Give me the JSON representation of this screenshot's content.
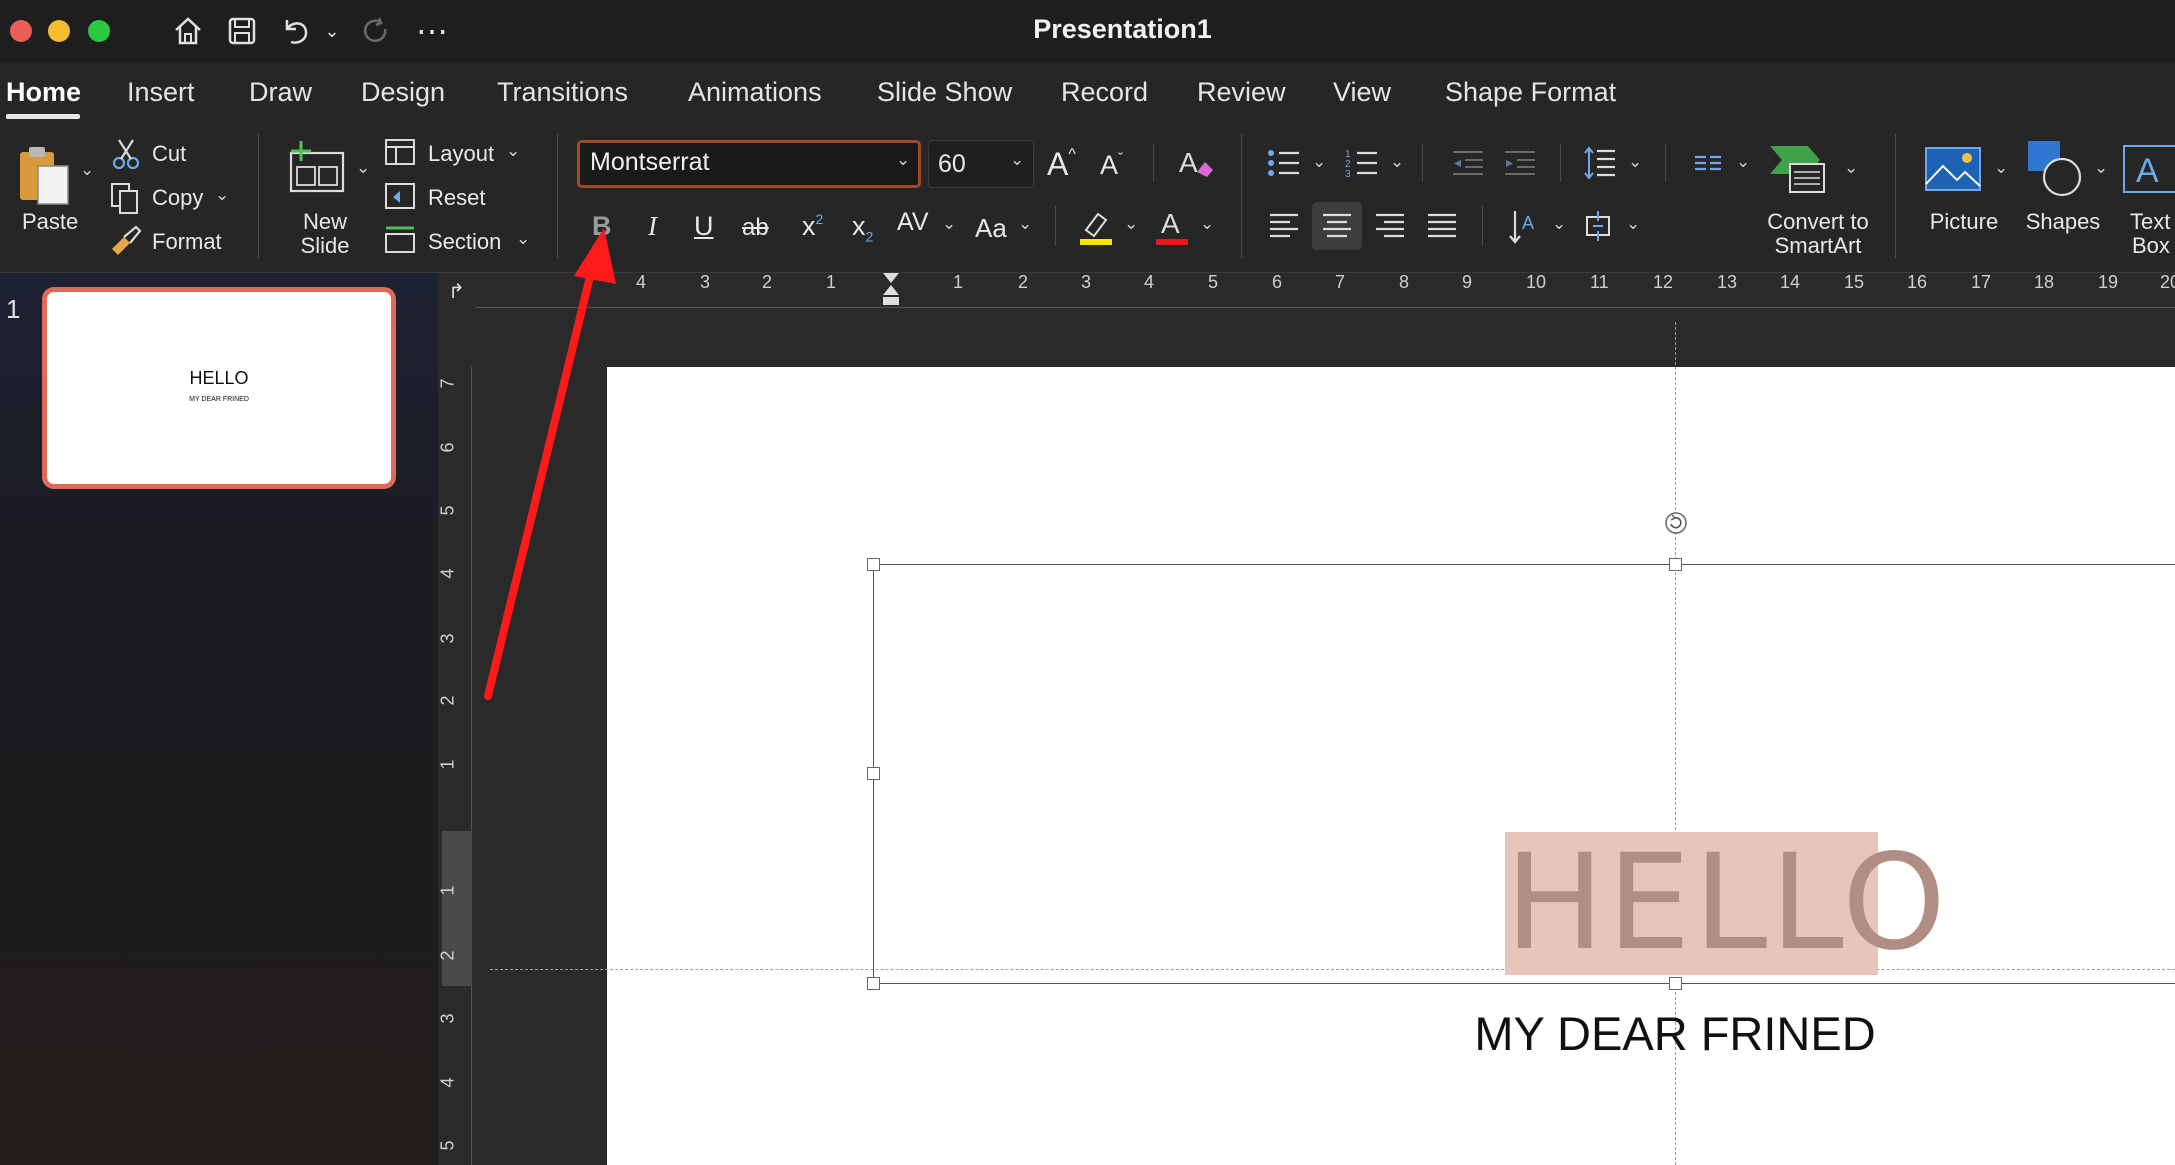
{
  "window": {
    "title": "Presentation1",
    "traffic_lights": [
      "#ec5f57",
      "#f4be2f",
      "#2cc840"
    ]
  },
  "quick_access": {
    "icons": [
      "home-icon",
      "save-icon",
      "undo-icon",
      "chevron-down-icon",
      "redo-icon",
      "more-icon"
    ]
  },
  "tabs": [
    {
      "label": "Home",
      "active": true
    },
    {
      "label": "Insert"
    },
    {
      "label": "Draw"
    },
    {
      "label": "Design"
    },
    {
      "label": "Transitions"
    },
    {
      "label": "Animations"
    },
    {
      "label": "Slide Show"
    },
    {
      "label": "Record"
    },
    {
      "label": "Review"
    },
    {
      "label": "View"
    },
    {
      "label": "Shape Format"
    }
  ],
  "ribbon": {
    "paste": "Paste",
    "cut": "Cut",
    "copy": "Copy",
    "format": "Format",
    "new_slide_line1": "New",
    "new_slide_line2": "Slide",
    "layout": "Layout",
    "reset": "Reset",
    "section": "Section",
    "font_name": "Montserrat",
    "font_size": "60",
    "bold": "B",
    "italic": "I",
    "underline": "U",
    "strike": "ab",
    "superscript": "x",
    "subscript": "x",
    "char_spacing": "AV",
    "change_case": "Aa",
    "convert_line1": "Convert to",
    "convert_line2": "SmartArt",
    "picture": "Picture",
    "shapes": "Shapes",
    "textbox_line1": "Text",
    "textbox_line2": "Box",
    "highlight_color": "#f5e600",
    "font_color": "#e51b1b"
  },
  "slides_panel": {
    "slide_number": "1",
    "thumb_title": "HELLO",
    "thumb_subtitle": "MY DEAR FRINED"
  },
  "rulers": {
    "horizontal": [
      "4",
      "3",
      "2",
      "1",
      "1",
      "2",
      "3",
      "4",
      "5",
      "6",
      "7",
      "8",
      "9",
      "10",
      "11",
      "12",
      "13",
      "14",
      "15",
      "16",
      "17",
      "18",
      "19",
      "20"
    ],
    "vertical": [
      "7",
      "6",
      "5",
      "4",
      "3",
      "2",
      "1",
      "1",
      "2",
      "3",
      "4",
      "5"
    ]
  },
  "slide": {
    "title": "HELLO",
    "subtitle": "MY DEAR FRINED",
    "title_highlight": "#e7c5bd"
  },
  "annotation": {
    "arrow_color": "#ff1a1a"
  }
}
